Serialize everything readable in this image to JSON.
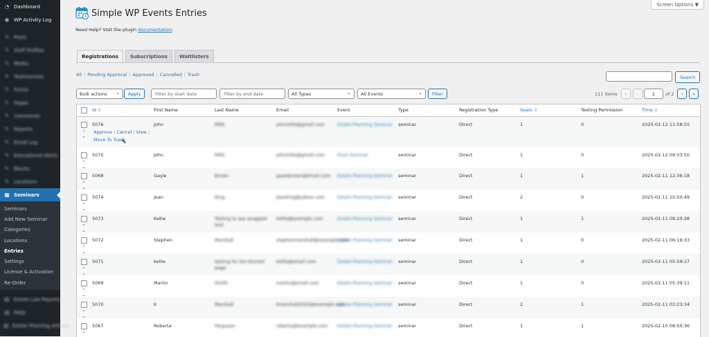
{
  "sidebar": {
    "top_items": [
      {
        "label": "Dashboard",
        "icon": "dashboard-icon"
      },
      {
        "label": "WP Activity Log",
        "icon": "activity-log-icon"
      }
    ],
    "blurred_items": [
      "Posts",
      "Staff Profiles",
      "Media",
      "Testimonials",
      "Forms",
      "Pages",
      "Comments",
      "Reports",
      "Email Log",
      "Educational Alerts",
      "Blocks",
      "Locations"
    ],
    "active_item": {
      "label": "Seminars",
      "icon": "calendar-icon"
    },
    "sub_items": [
      "Seminars",
      "Add New Seminar",
      "Categories",
      "Locations",
      "Entries",
      "Settings",
      "License & Activation",
      "Re-Order"
    ],
    "current_sub": "Entries",
    "bottom_blurred": [
      "Estate Law Reports",
      "FAQs",
      "Estate Planning Articles"
    ]
  },
  "header": {
    "screen_options": "Screen Options ▼",
    "title": "Simple WP Events Entries",
    "help_text": "Need Help? Visit the plugin",
    "help_link": "documentation",
    "help_end": "."
  },
  "tabs": [
    "Registrations",
    "Subscriptions",
    "Waitlisters"
  ],
  "filters_links": [
    "All",
    "Pending Approval",
    "Approved",
    "Cancelled",
    "Trash"
  ],
  "search": {
    "button": "Search"
  },
  "tablenav": {
    "bulk_actions": "Bulk actions",
    "apply": "Apply",
    "start_placeholder": "Filter by start date",
    "end_placeholder": "Filter by end date",
    "types": "All Types",
    "events": "All Events",
    "filter": "Filter",
    "items": "111 items",
    "page": "1",
    "of_pages": "of 2",
    "first": "«",
    "prev": "‹",
    "next": "›",
    "last": "»"
  },
  "columns": {
    "id": "Id",
    "first": "First Name",
    "last": "Last Name",
    "email": "Email",
    "event": "Event",
    "type": "Type",
    "reg_type": "Registration Type",
    "seats": "Seats",
    "texting": "Texting Permission",
    "time": "Time"
  },
  "row_actions": {
    "approve": "Approve",
    "cancel": "Cancel",
    "view": "View",
    "trash": "Move To Trash"
  },
  "rows": [
    {
      "id": "5076",
      "first": "John",
      "last": "Mills",
      "email": "johnmills@gmail.com",
      "event": "Estate Planning Seminar",
      "type": "seminar",
      "reg_type": "Direct",
      "seats": "1",
      "texting": "0",
      "time": "2025-02-12 11:58:55"
    },
    {
      "id": "5075",
      "first": "John",
      "last": "Mills",
      "email": "johnmills@gmail.com",
      "event": "Trust Seminar",
      "type": "seminar",
      "reg_type": "Direct",
      "seats": "1",
      "texting": "0",
      "time": "2025-02-12 09:33:50"
    },
    {
      "id": "5068",
      "first": "Gayle",
      "last": "Brown",
      "email": "gaylebrown@email.com",
      "event": "Estate Planning Seminar",
      "type": "seminar",
      "reg_type": "Direct",
      "seats": "1",
      "texting": "1",
      "time": "2025-02-11 12:36:18"
    },
    {
      "id": "5074",
      "first": "Jean",
      "last": "King",
      "email": "jeanking@yahoo.com",
      "event": "Estate Planning Seminar",
      "type": "seminar",
      "reg_type": "Direct",
      "seats": "2",
      "texting": "0",
      "time": "2025-02-11 10:50:49"
    },
    {
      "id": "5073",
      "first": "Kellie",
      "last": "Testing to see wrapped text",
      "email": "kellie@example.com",
      "event": "Estate Planning Seminar",
      "type": "seminar",
      "reg_type": "Direct",
      "seats": "1",
      "texting": "1",
      "time": "2025-02-11 09:20:38"
    },
    {
      "id": "5072",
      "first": "Stephen",
      "last": "Marshall",
      "email": "stephenmarshall@example.com",
      "event": "Estate Planning Seminar",
      "type": "seminar",
      "reg_type": "Direct",
      "seats": "1",
      "texting": "0",
      "time": "2025-02-11 06:19:33"
    },
    {
      "id": "5071",
      "first": "kellie",
      "last": "testing for the blurred page",
      "email": "kellie@email.com",
      "event": "Estate Planning Seminar",
      "type": "seminar",
      "reg_type": "Direct",
      "seats": "1",
      "texting": "0",
      "time": "2025-02-11 05:59:27"
    },
    {
      "id": "5069",
      "first": "Martin",
      "last": "Smith",
      "email": "martin@email.com",
      "event": "Estate Planning Seminar",
      "type": "seminar",
      "reg_type": "Direct",
      "seats": "1",
      "texting": "0",
      "time": "2025-02-11 05:39:11"
    },
    {
      "id": "5070",
      "first": "K",
      "last": "Marshall",
      "email": "kmarshall2025@example.com",
      "event": "Estate Planning Seminar",
      "type": "seminar",
      "reg_type": "Direct",
      "seats": "2",
      "texting": "1",
      "time": "2025-02-11 03:23:34"
    },
    {
      "id": "5067",
      "first": "Roberta",
      "last": "Ferguson",
      "email": "roberta@example.com",
      "event": "Estate Planning Seminar",
      "type": "seminar",
      "reg_type": "Direct",
      "seats": "1",
      "texting": "1",
      "time": "2025-02-10 08:50:36"
    }
  ]
}
